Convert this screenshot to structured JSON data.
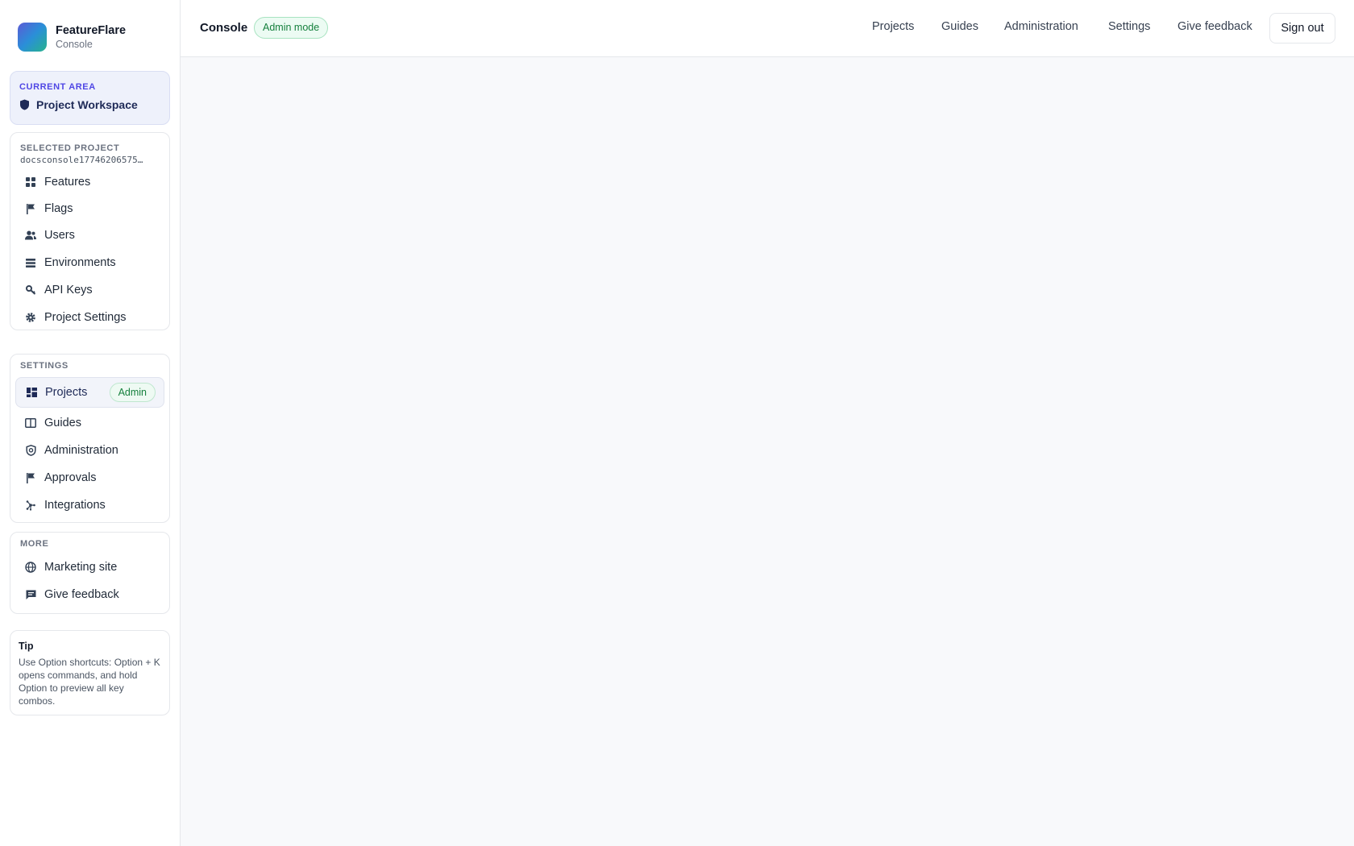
{
  "brand": {
    "name": "FeatureFlare",
    "subtitle": "Console"
  },
  "current_area": {
    "label": "CURRENT AREA",
    "value": "Project Workspace"
  },
  "project_section": {
    "label": "SELECTED PROJECT",
    "project_id": "docsconsole17746206575…",
    "items": [
      {
        "label": "Features",
        "icon": "grid-icon"
      },
      {
        "label": "Flags",
        "icon": "flag-icon"
      },
      {
        "label": "Users",
        "icon": "users-icon"
      },
      {
        "label": "Environments",
        "icon": "layers-icon"
      },
      {
        "label": "API Keys",
        "icon": "key-icon"
      },
      {
        "label": "Project Settings",
        "icon": "gear-icon"
      }
    ]
  },
  "settings_section": {
    "label": "SETTINGS",
    "items": [
      {
        "label": "Projects",
        "icon": "dashboard-icon",
        "badge": "Admin",
        "active": true
      },
      {
        "label": "Guides",
        "icon": "book-icon"
      },
      {
        "label": "Administration",
        "icon": "shield-gear-icon"
      },
      {
        "label": "Approvals",
        "icon": "flag-icon"
      },
      {
        "label": "Integrations",
        "icon": "hub-icon"
      }
    ]
  },
  "more_section": {
    "label": "MORE",
    "items": [
      {
        "label": "Marketing site",
        "icon": "globe-icon"
      },
      {
        "label": "Give feedback",
        "icon": "chat-icon"
      }
    ]
  },
  "tip": {
    "title": "Tip",
    "body": "Use Option shortcuts: Option + K opens commands, and hold Option to preview all key combos."
  },
  "header": {
    "title": "Console",
    "mode_badge": "Admin mode",
    "nav": [
      "Projects",
      "Guides",
      "Administration",
      "Settings",
      "Give feedback"
    ],
    "signout": "Sign out"
  },
  "colors": {
    "accent": "#4f46e5",
    "success": "#15803d",
    "background": "#f8f9fb"
  }
}
